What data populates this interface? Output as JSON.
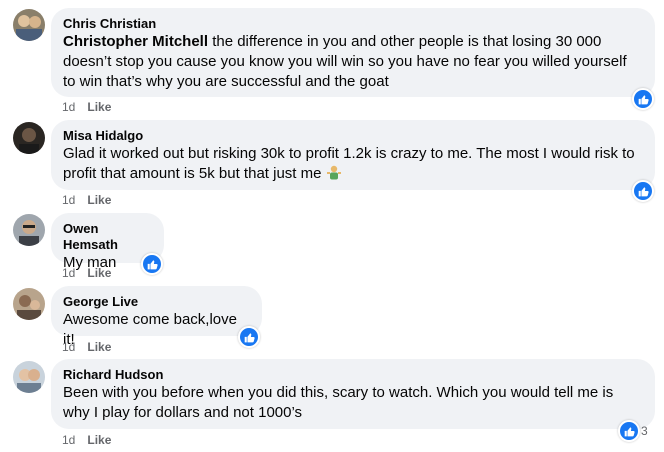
{
  "comments": [
    {
      "author": "Chris Christian",
      "mention": "Christopher Mitchell",
      "line1": "the difference in you and other people is that losing 30 000",
      "line2": "doesn’t stop you cause you know you will win so you have no fear you willed yourself",
      "line3": "to win that’s why you are successful and the goat",
      "time": "1d",
      "like_label": "Like",
      "reaction": "like-icon"
    },
    {
      "author": "Misa Hidalgo",
      "line1": "Glad it worked out but risking 30k to profit 1.2k is crazy to me. The most I would risk to",
      "line2": "profit that amount is 5k but that just me",
      "emoji": "person-shrugging-emoji",
      "time": "1d",
      "like_label": "Like",
      "reaction": "like-icon"
    },
    {
      "author": "Owen Hemsath",
      "line1": "My man",
      "time": "1d",
      "like_label": "Like",
      "reaction": "like-icon"
    },
    {
      "author": "George Live",
      "line1": "Awesome come back,love it!",
      "time": "1d",
      "like_label": "Like",
      "reaction": "like-icon"
    },
    {
      "author": "Richard Hudson",
      "line1": "Been with you before when you did this, scary to watch. Which you would tell me is",
      "line2": "why I play for dollars and not 1000’s",
      "time": "1d",
      "like_label": "Like",
      "reaction": "like-icon",
      "reaction_count": "3"
    }
  ],
  "colors": {
    "bubble": "#f0f2f5",
    "meta": "#65676b",
    "like_blue": "#1877f2"
  }
}
